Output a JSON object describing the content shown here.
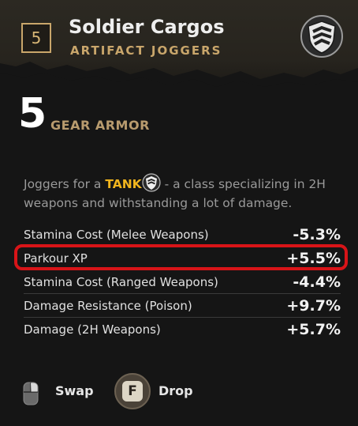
{
  "item": {
    "level": "5",
    "name": "Soldier Cargos",
    "type": "ARTIFACT JOGGERS",
    "class_emblem_icon": "shield-chevron-icon"
  },
  "armor": {
    "value": "5",
    "label": "GEAR ARMOR"
  },
  "description": {
    "prefix": "Joggers for a",
    "class_name": "TANK",
    "suffix": " - a class specializing in 2H weapons and withstanding a lot of damage."
  },
  "stats": [
    {
      "name": "Stamina Cost (Melee Weapons)",
      "value": "-5.3%"
    },
    {
      "name": "Parkour XP",
      "value": "+5.5%"
    },
    {
      "name": "Stamina Cost (Ranged Weapons)",
      "value": "-4.4%"
    },
    {
      "name": "Damage Resistance (Poison)",
      "value": "+9.7%"
    },
    {
      "name": "Damage (2H Weapons)",
      "value": "+5.7%"
    }
  ],
  "actions": {
    "swap_label": "Swap",
    "drop_key": "F",
    "drop_label": "Drop"
  },
  "colors": {
    "accent_gold": "#c9a66b",
    "tank_yellow": "#f0b41e",
    "highlight_red": "#d81418"
  }
}
